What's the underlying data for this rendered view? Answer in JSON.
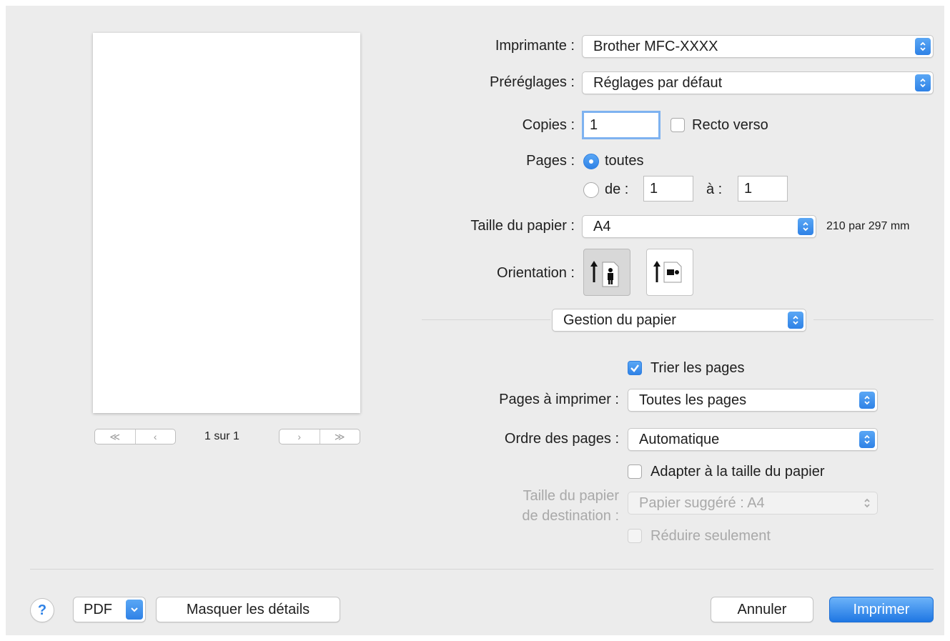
{
  "colors": {
    "accent": "#2f82e6",
    "dialog_bg": "#ececec",
    "disabled_text": "#a9a9a9"
  },
  "preview": {
    "first_icon": "double-chevron-left-icon",
    "prev_icon": "chevron-left-icon",
    "next_icon": "chevron-right-icon",
    "last_icon": "double-chevron-right-icon",
    "page_indicator": "1 sur 1"
  },
  "printer": {
    "label": "Imprimante :",
    "value": "Brother MFC-XXXX"
  },
  "presets": {
    "label": "Préréglages :",
    "value": "Réglages par défaut"
  },
  "copies": {
    "label": "Copies :",
    "value": "1",
    "duplex_label": "Recto verso",
    "duplex_checked": false
  },
  "pages": {
    "label": "Pages :",
    "all_label": "toutes",
    "range_from_label": "de :",
    "range_from_value": "1",
    "range_to_label": "à :",
    "range_to_value": "1",
    "selected": "all"
  },
  "paper_size": {
    "label": "Taille du papier :",
    "value": "A4",
    "dimensions": "210 par 297 mm"
  },
  "orientation": {
    "label": "Orientation :",
    "options": [
      "portrait",
      "landscape"
    ],
    "selected": "portrait"
  },
  "section_popup": {
    "value": "Gestion du papier"
  },
  "collate": {
    "label": "Trier les pages",
    "checked": true
  },
  "pages_to_print": {
    "label": "Pages à imprimer :",
    "value": "Toutes les pages"
  },
  "page_order": {
    "label": "Ordre des pages :",
    "value": "Automatique"
  },
  "scale_to_fit": {
    "label": "Adapter à la taille du papier",
    "checked": false
  },
  "destination_paper": {
    "label_line1": "Taille du papier",
    "label_line2": "de destination :",
    "value": "Papier suggéré : A4",
    "enabled": false
  },
  "scale_down_only": {
    "label": "Réduire seulement",
    "checked": false,
    "enabled": false
  },
  "footer": {
    "help_label": "?",
    "pdf_label": "PDF",
    "hide_details_label": "Masquer les détails",
    "cancel_label": "Annuler",
    "print_label": "Imprimer"
  }
}
